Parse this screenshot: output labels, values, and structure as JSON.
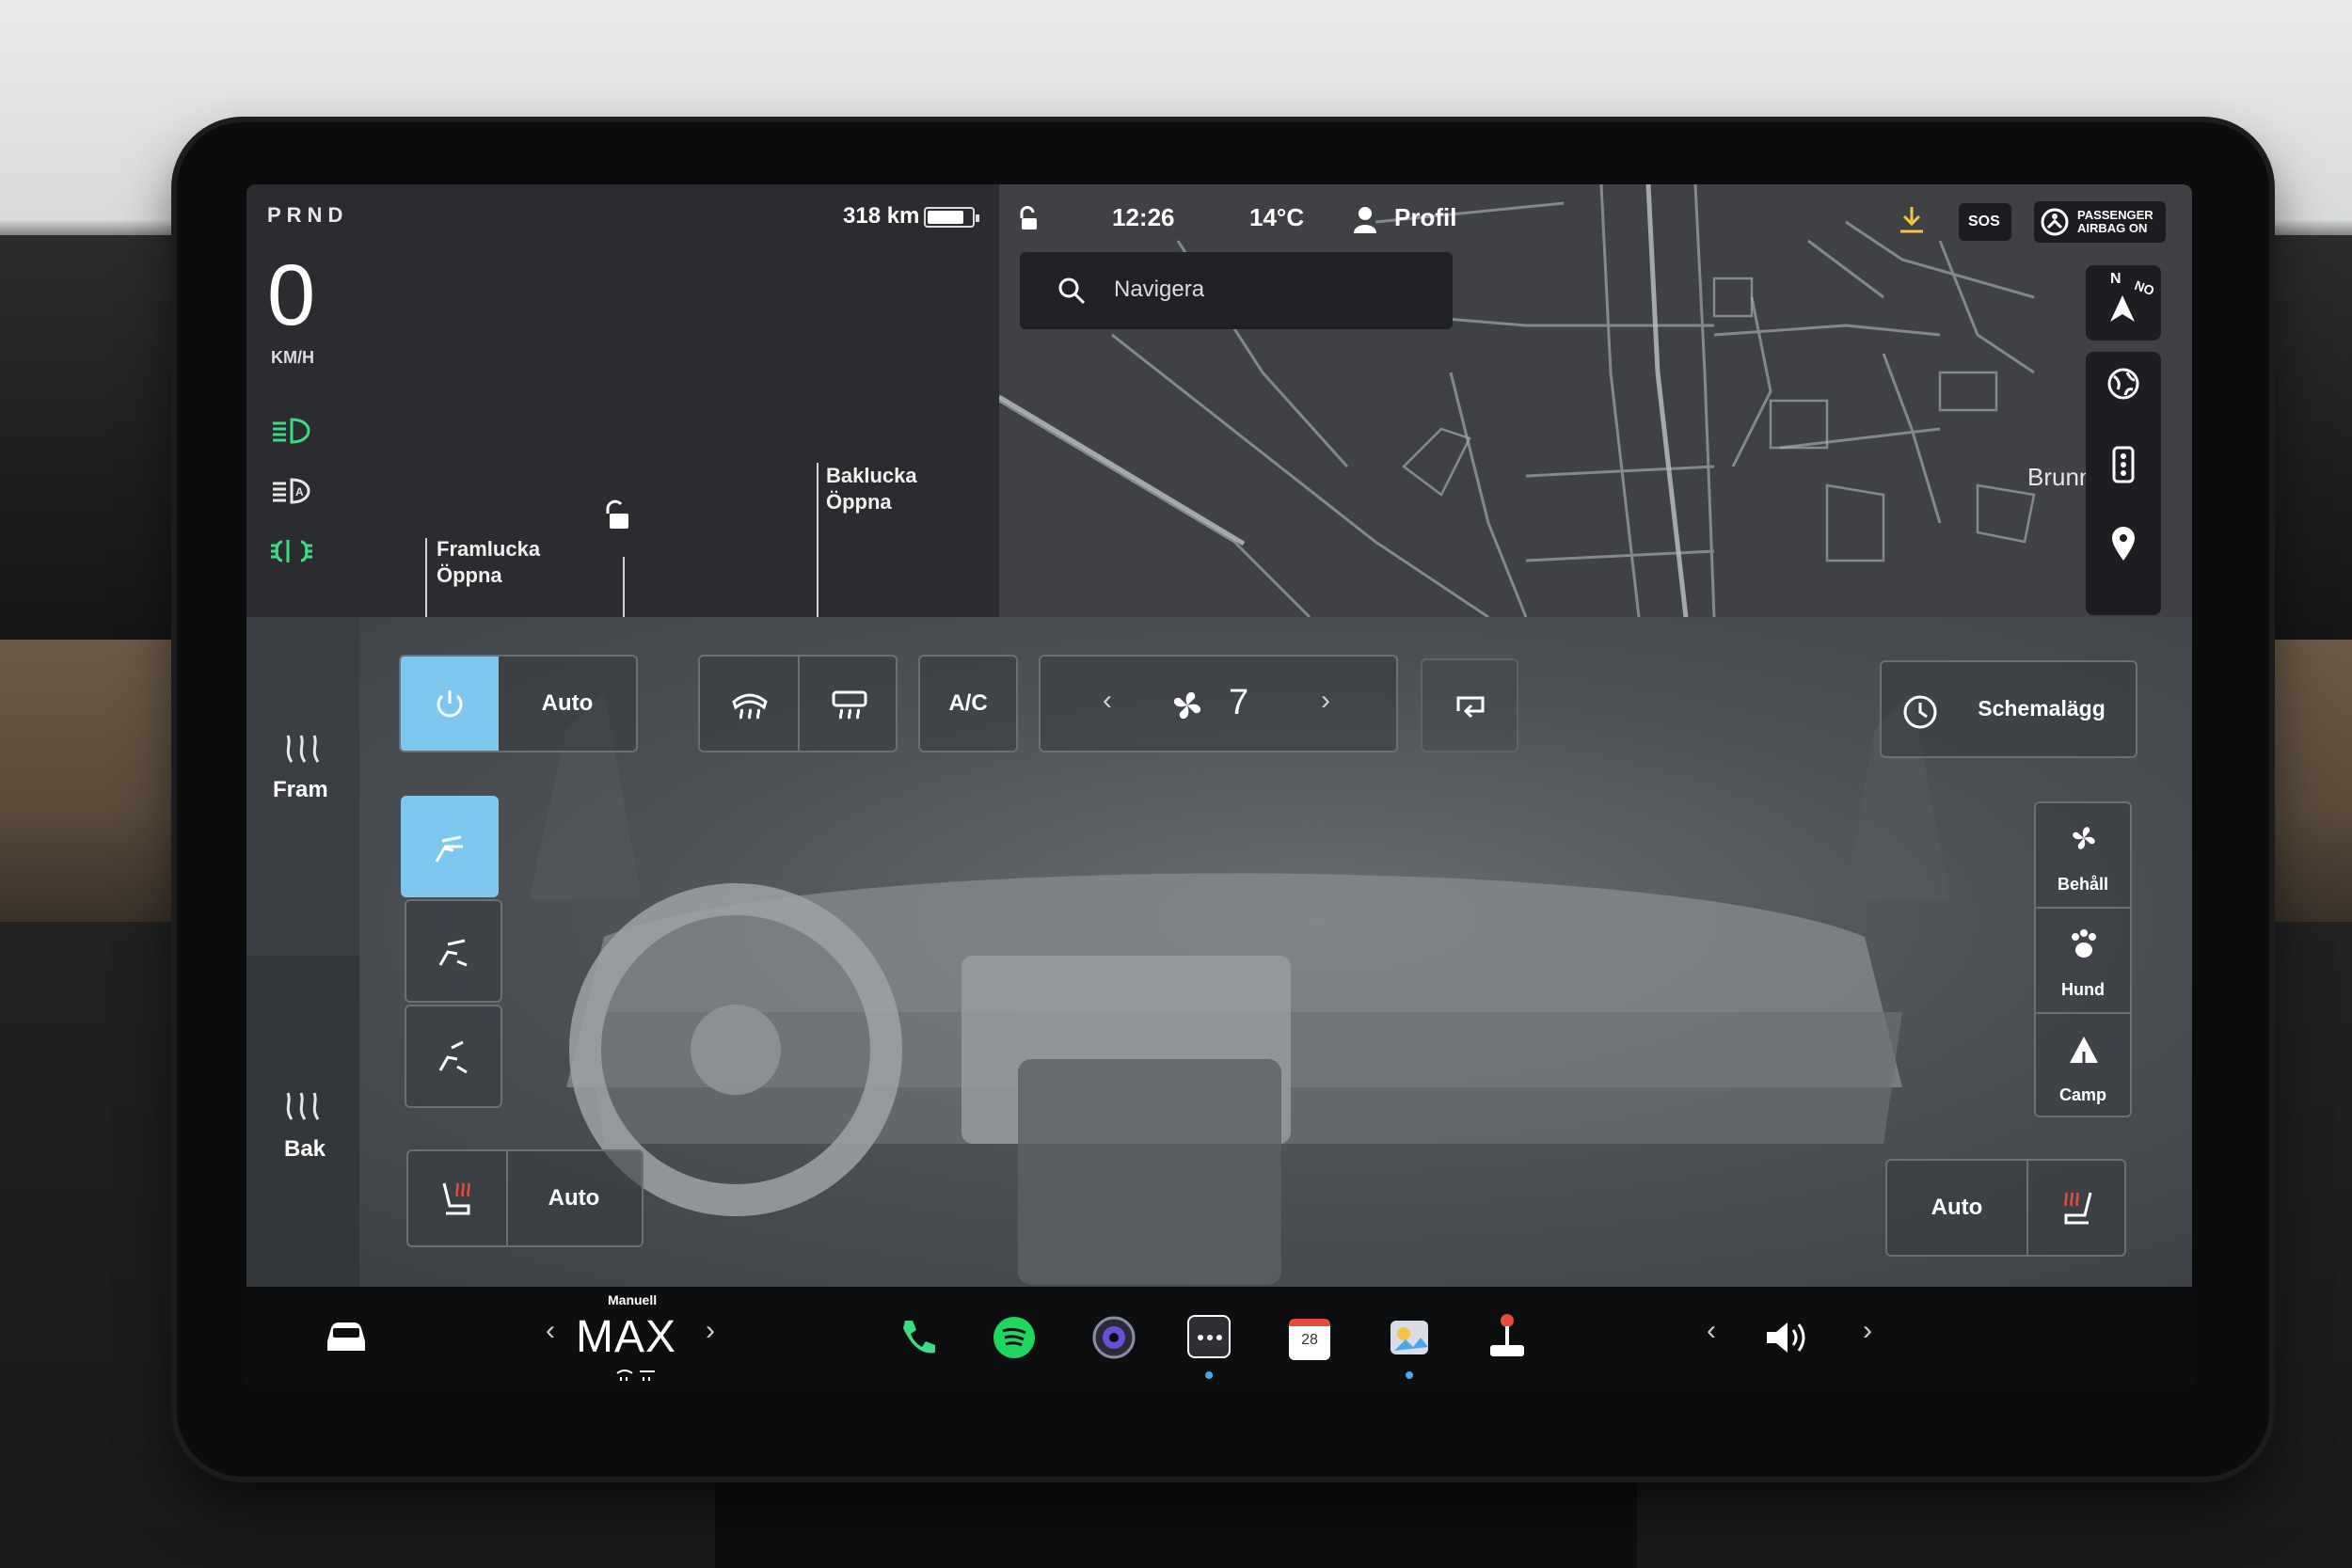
{
  "status": {
    "gear": "PRND",
    "speed": "0",
    "speed_unit": "KM/H",
    "range": "318 km",
    "battery_fraction": 0.82,
    "frunk_title": "Framlucka",
    "frunk_action": "Öppna",
    "trunk_title": "Baklucka",
    "trunk_action": "Öppna",
    "light_icons": [
      "low-beam-icon",
      "auto-high-beam-icon",
      "fog-light-icon"
    ]
  },
  "topbar": {
    "time": "12:26",
    "temperature": "14°C",
    "profile": "Profil",
    "sos": "SOS",
    "airbag_line1": "PASSENGER",
    "airbag_line2": "AIRBAG ON"
  },
  "map": {
    "search_placeholder": "Navigera",
    "place_label": "Brunn",
    "compass_n": "N",
    "compass_ne": "NO"
  },
  "climate": {
    "power_auto": "Auto",
    "ac": "A/C",
    "fan_level": "7",
    "schedule": "Schemalägg",
    "front_label": "Fram",
    "rear_label": "Bak",
    "seat_left_auto": "Auto",
    "seat_right_auto": "Auto",
    "modes": [
      {
        "label": "Behåll",
        "icon": "fan-keep-icon"
      },
      {
        "label": "Hund",
        "icon": "paw-icon"
      },
      {
        "label": "Camp",
        "icon": "tent-icon"
      }
    ]
  },
  "taskbar": {
    "mode": "Manuell",
    "fan_text": "MAX",
    "calendar_day": "28"
  },
  "colors": {
    "accent": "#7ec8ef",
    "green_icon": "#3ddc84",
    "spotify": "#1ed760",
    "dot": "#4aa8e8"
  }
}
